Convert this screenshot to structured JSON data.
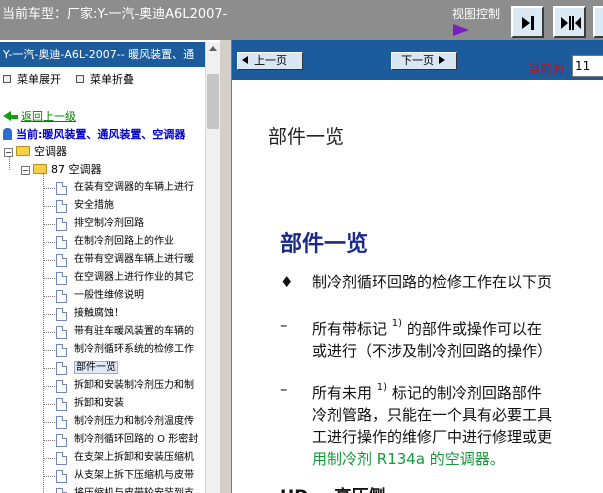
{
  "topbar": {
    "car_title": "当前车型：厂家:Y-一汽-奥迪A6L2007-",
    "view_control_label": "视图控制"
  },
  "sidebar": {
    "header": "Y-一汽-奥迪-A6L-2007-- 暖风装置、通",
    "expand_all": "菜单展开",
    "collapse_all": "菜单折叠",
    "back_link": "返回上一级",
    "current_node": "当前:暖风装置、通风装置、空调器",
    "tree": {
      "level1": "空调器",
      "level2": "87 空调器",
      "items": [
        "在装有空调器的车辆上进行",
        "安全措施",
        "排空制冷剂回路",
        "在制冷剂回路上的作业",
        "在带有空调器车辆上进行暖",
        "在空调器上进行作业的其它",
        "一般性维修说明",
        "接触腐蚀！",
        "带有驻车暖风装置的车辆的",
        "制冷剂循环系统的检修工作",
        "部件一览",
        "拆卸和安装制冷剂压力和制",
        "拆卸和安装",
        "制冷剂压力和制冷剂温度传",
        "制冷剂循环回路的 O 形密封",
        "在支架上拆卸和安装压缩机",
        "从支架上拆下压缩机与皮带",
        "将压缩机与皮带轮安装到支"
      ],
      "selected_index": 10
    }
  },
  "nav": {
    "prev_page": "上一页",
    "next_page": "下一页",
    "current_label": "当前为",
    "current_value": "11"
  },
  "document": {
    "page_heading": "部件一览",
    "section_title": "部件一览",
    "bullet_marker": "♦",
    "dash_marker": "–",
    "p1": "制冷剂循环回路的检修工作在以下页",
    "p2_line1_a": "所有带标记",
    "p2_sup": "1)",
    "p2_line1_b": "的部件或操作可以在",
    "p2_line2": "或进行（不涉及制冷剂回路的操作）",
    "p3_line1_a": "所有未用",
    "p3_sup": "1)",
    "p3_line1_b": "标记的制冷剂回路部件",
    "p3_line2": "冷剂管路，只能在一个具有必要工具",
    "p3_line3": "工进行操作的维修厂中进行修理或更",
    "p3_line4": "用制冷剂 R134a 的空调器。",
    "hd_title": "HD = 高压侧"
  },
  "colors": {
    "topbar": "#8d8d8d",
    "header_blue": "#1c5c9c",
    "section_title": "#1a2a8a",
    "green_text": "#139b3a",
    "red_label": "#e00000"
  }
}
